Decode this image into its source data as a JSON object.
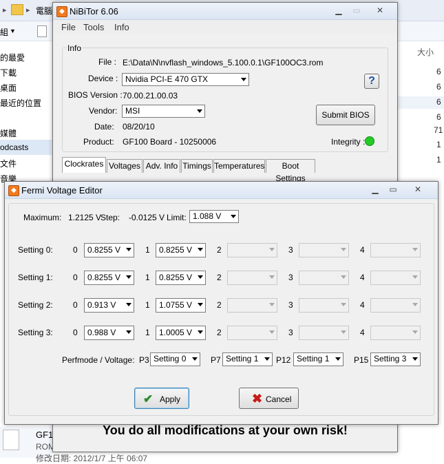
{
  "explorer": {
    "breadcrumb": "電腦",
    "organize": "組",
    "column_size": "大小",
    "nav": [
      "的最愛",
      "下載",
      "桌面",
      "最近的位置",
      "媒體",
      "odcasts",
      "文件",
      "音樂"
    ],
    "sizes": [
      "6",
      "6",
      "6",
      "6",
      "71",
      "1",
      "1"
    ],
    "file_name": "GF1",
    "file_sub": "ROM",
    "file_date": "修改日期: 2012/1/7 上午 06:07"
  },
  "nibitor": {
    "title": "NiBiTor 6.06",
    "menu": [
      "File",
      "Tools",
      "Info"
    ],
    "info_group": "Info",
    "file_label": "File :",
    "file_value": "E:\\Data\\N\\nvflash_windows_5.100.0.1\\GF100OC3.rom",
    "device_label": "Device :",
    "device_value": "Nvidia PCI-E 470 GTX",
    "bios_label": "BIOS Version :",
    "bios_value": "70.00.21.00.03",
    "vendor_label": "Vendor:",
    "vendor_value": "MSI",
    "date_label": "Date:",
    "date_value": "08/20/10",
    "product_label": "Product:",
    "product_value": "GF100 Board - 10250006",
    "submit_label": "Submit BIOS",
    "integrity_label": "Integrity :",
    "integrity_color": "#22cc22",
    "help_label": "?",
    "tabs": [
      "Clockrates",
      "Voltages",
      "Adv. Info",
      "Timings",
      "Temperatures",
      "Boot Settings"
    ],
    "warning": "You do all modifications at your own risk!"
  },
  "editor": {
    "title": "Fermi Voltage Editor",
    "maximum_label": "Maximum:",
    "maximum_value": "1.2125 V",
    "step_label": "Step:",
    "step_value": "-0.0125 V",
    "limit_label": "Limit:",
    "limit_value": "1.088 V",
    "index_labels": [
      "0",
      "1",
      "2",
      "3",
      "4"
    ],
    "settings": [
      {
        "label": "Setting 0:",
        "values": [
          "0.8255 V",
          "0.8255 V",
          "",
          "",
          ""
        ]
      },
      {
        "label": "Setting 1:",
        "values": [
          "0.8255 V",
          "0.8255 V",
          "",
          "",
          ""
        ]
      },
      {
        "label": "Setting 2:",
        "values": [
          "0.913 V",
          "1.0755 V",
          "",
          "",
          ""
        ]
      },
      {
        "label": "Setting 3:",
        "values": [
          "0.988 V",
          "1.0005 V",
          "",
          "",
          ""
        ]
      }
    ],
    "perf_label": "Perfmode / Voltage:",
    "perf": [
      {
        "label": "P3",
        "value": "Setting 0"
      },
      {
        "label": "P7",
        "value": "Setting 1"
      },
      {
        "label": "P12",
        "value": "Setting 1"
      },
      {
        "label": "P15",
        "value": "Setting 3"
      }
    ],
    "apply_label": "Apply",
    "cancel_label": "Cancel"
  }
}
